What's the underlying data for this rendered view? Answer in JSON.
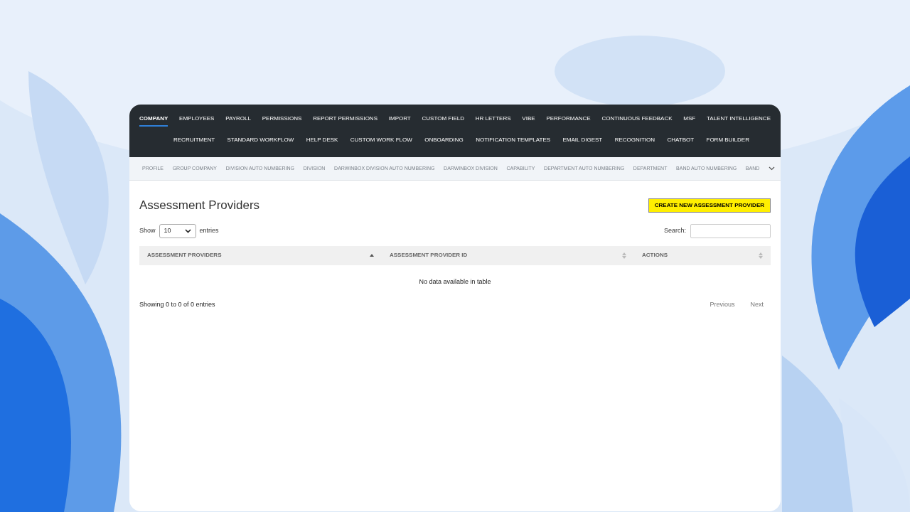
{
  "main_nav": {
    "first_row": [
      {
        "label": "COMPANY",
        "selected": true
      },
      {
        "label": "EMPLOYEES",
        "selected": false
      },
      {
        "label": "PAYROLL",
        "selected": false
      },
      {
        "label": "PERMISSIONS",
        "selected": false
      },
      {
        "label": "REPORT PERMISSIONS",
        "selected": false
      },
      {
        "label": "IMPORT",
        "selected": false
      },
      {
        "label": "CUSTOM FIELD",
        "selected": false
      },
      {
        "label": "HR LETTERS",
        "selected": false
      },
      {
        "label": "VIBE",
        "selected": false
      },
      {
        "label": "PERFORMANCE",
        "selected": false
      },
      {
        "label": "CONTINUOUS FEEDBACK",
        "selected": false
      },
      {
        "label": "MSF",
        "selected": false
      },
      {
        "label": "TALENT INTELLIGENCE",
        "selected": false
      }
    ],
    "second_row": [
      {
        "label": "RECRUITMENT",
        "selected": false
      },
      {
        "label": "STANDARD WORKFLOW",
        "selected": false
      },
      {
        "label": "HELP DESK",
        "selected": false
      },
      {
        "label": "CUSTOM WORK FLOW",
        "selected": false
      },
      {
        "label": "ONBOARDING",
        "selected": false
      },
      {
        "label": "NOTIFICATION TEMPLATES",
        "selected": false
      },
      {
        "label": "EMAIL DIGEST",
        "selected": false
      },
      {
        "label": "RECOGNITION",
        "selected": false
      },
      {
        "label": "CHATBOT",
        "selected": false
      },
      {
        "label": "FORM BUILDER",
        "selected": false
      }
    ]
  },
  "sub_nav": [
    "PROFILE",
    "GROUP COMPANY",
    "DIVISION AUTO NUMBERING",
    "DIVISION",
    "DARWINBOX DIVISION AUTO NUMBERING",
    "DARWINBOX DIVISION",
    "CAPABILITY",
    "DEPARTMENT AUTO NUMBERING",
    "DEPARTMENT",
    "BAND AUTO NUMBERING",
    "BAND"
  ],
  "page": {
    "title": "Assessment Providers",
    "create_button": "CREATE NEW ASSESSMENT PROVIDER"
  },
  "length": {
    "before": "Show",
    "value": "10",
    "after": "entries"
  },
  "search": {
    "label": "Search:"
  },
  "table": {
    "columns": [
      {
        "label": "ASSESSMENT PROVIDERS",
        "sorted": true
      },
      {
        "label": "ASSESSMENT PROVIDER ID",
        "sorted": false
      },
      {
        "label": "ACTIONS",
        "sorted": false
      }
    ],
    "empty": "No data available in table"
  },
  "footer": {
    "info": "Showing 0 to 0 of 0 entries",
    "previous": "Previous",
    "next": "Next"
  }
}
